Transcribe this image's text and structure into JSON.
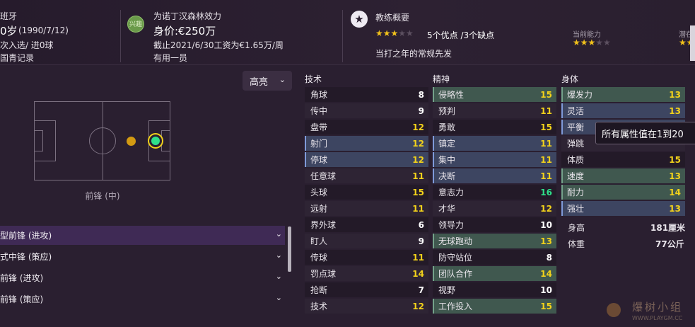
{
  "header": {
    "nation_fragment": "班牙",
    "age_birth_age": "0岁",
    "age_birth_date": "(1990/7/12)",
    "caps": "次入选/ 进0球",
    "youth": "国青记录",
    "club_badge": "兴趣",
    "club_line": "为诺丁汉森林效力",
    "value": "身价:€250万",
    "contract": "截止2021/6/30工资为€1.65万/周",
    "role_desc": "有用一员",
    "coach_title": "教练概要",
    "strengths": "5个优点 /3个缺点",
    "squad_status": "当打之年的常规先发",
    "current_ability_label": "当前能力",
    "potential_label": "潜在",
    "star_icon": "star-icon"
  },
  "left": {
    "highlight_label": "高亮",
    "position_label": "前锋 (中)",
    "roles": [
      {
        "label": "型前锋 (进攻)"
      },
      {
        "label": "式中锋 (策应)"
      },
      {
        "label": "前锋 (进攻)"
      },
      {
        "label": "前锋 (策应)"
      }
    ]
  },
  "attributes": {
    "technical_title": "技术",
    "mental_title": "精神",
    "physical_title": "身体",
    "technical": [
      {
        "name": "角球",
        "value": "8"
      },
      {
        "name": "传中",
        "value": "9"
      },
      {
        "name": "盘带",
        "value": "12"
      },
      {
        "name": "射门",
        "value": "12"
      },
      {
        "name": "停球",
        "value": "12"
      },
      {
        "name": "任意球",
        "value": "11"
      },
      {
        "name": "头球",
        "value": "15"
      },
      {
        "name": "远射",
        "value": "11"
      },
      {
        "name": "界外球",
        "value": "6"
      },
      {
        "name": "盯人",
        "value": "9"
      },
      {
        "name": "传球",
        "value": "11"
      },
      {
        "name": "罚点球",
        "value": "14"
      },
      {
        "name": "抢断",
        "value": "7"
      },
      {
        "name": "技术",
        "value": "12"
      }
    ],
    "mental": [
      {
        "name": "侵略性",
        "value": "15"
      },
      {
        "name": "预判",
        "value": "11"
      },
      {
        "name": "勇敢",
        "value": "15"
      },
      {
        "name": "镇定",
        "value": "11"
      },
      {
        "name": "集中",
        "value": "11"
      },
      {
        "name": "决断",
        "value": "11"
      },
      {
        "name": "意志力",
        "value": "16"
      },
      {
        "name": "才华",
        "value": "12"
      },
      {
        "name": "领导力",
        "value": "10"
      },
      {
        "name": "无球跑动",
        "value": "13"
      },
      {
        "name": "防守站位",
        "value": "8"
      },
      {
        "name": "团队合作",
        "value": "14"
      },
      {
        "name": "视野",
        "value": "10"
      },
      {
        "name": "工作投入",
        "value": "15"
      }
    ],
    "physical": [
      {
        "name": "爆发力",
        "value": "13"
      },
      {
        "name": "灵活",
        "value": "13"
      },
      {
        "name": "平衡",
        "value": ""
      },
      {
        "name": "弹跳",
        "value": ""
      },
      {
        "name": "体质",
        "value": "15"
      },
      {
        "name": "速度",
        "value": "13"
      },
      {
        "name": "耐力",
        "value": "14"
      },
      {
        "name": "强壮",
        "value": "13"
      }
    ],
    "height_label": "身高",
    "height_value": "181厘米",
    "weight_label": "体重",
    "weight_value": "77公斤",
    "tooltip": "所有属性值在1到20"
  },
  "watermark": {
    "text": "爆树小组",
    "url": "WWW.PLAYGM.CC"
  }
}
